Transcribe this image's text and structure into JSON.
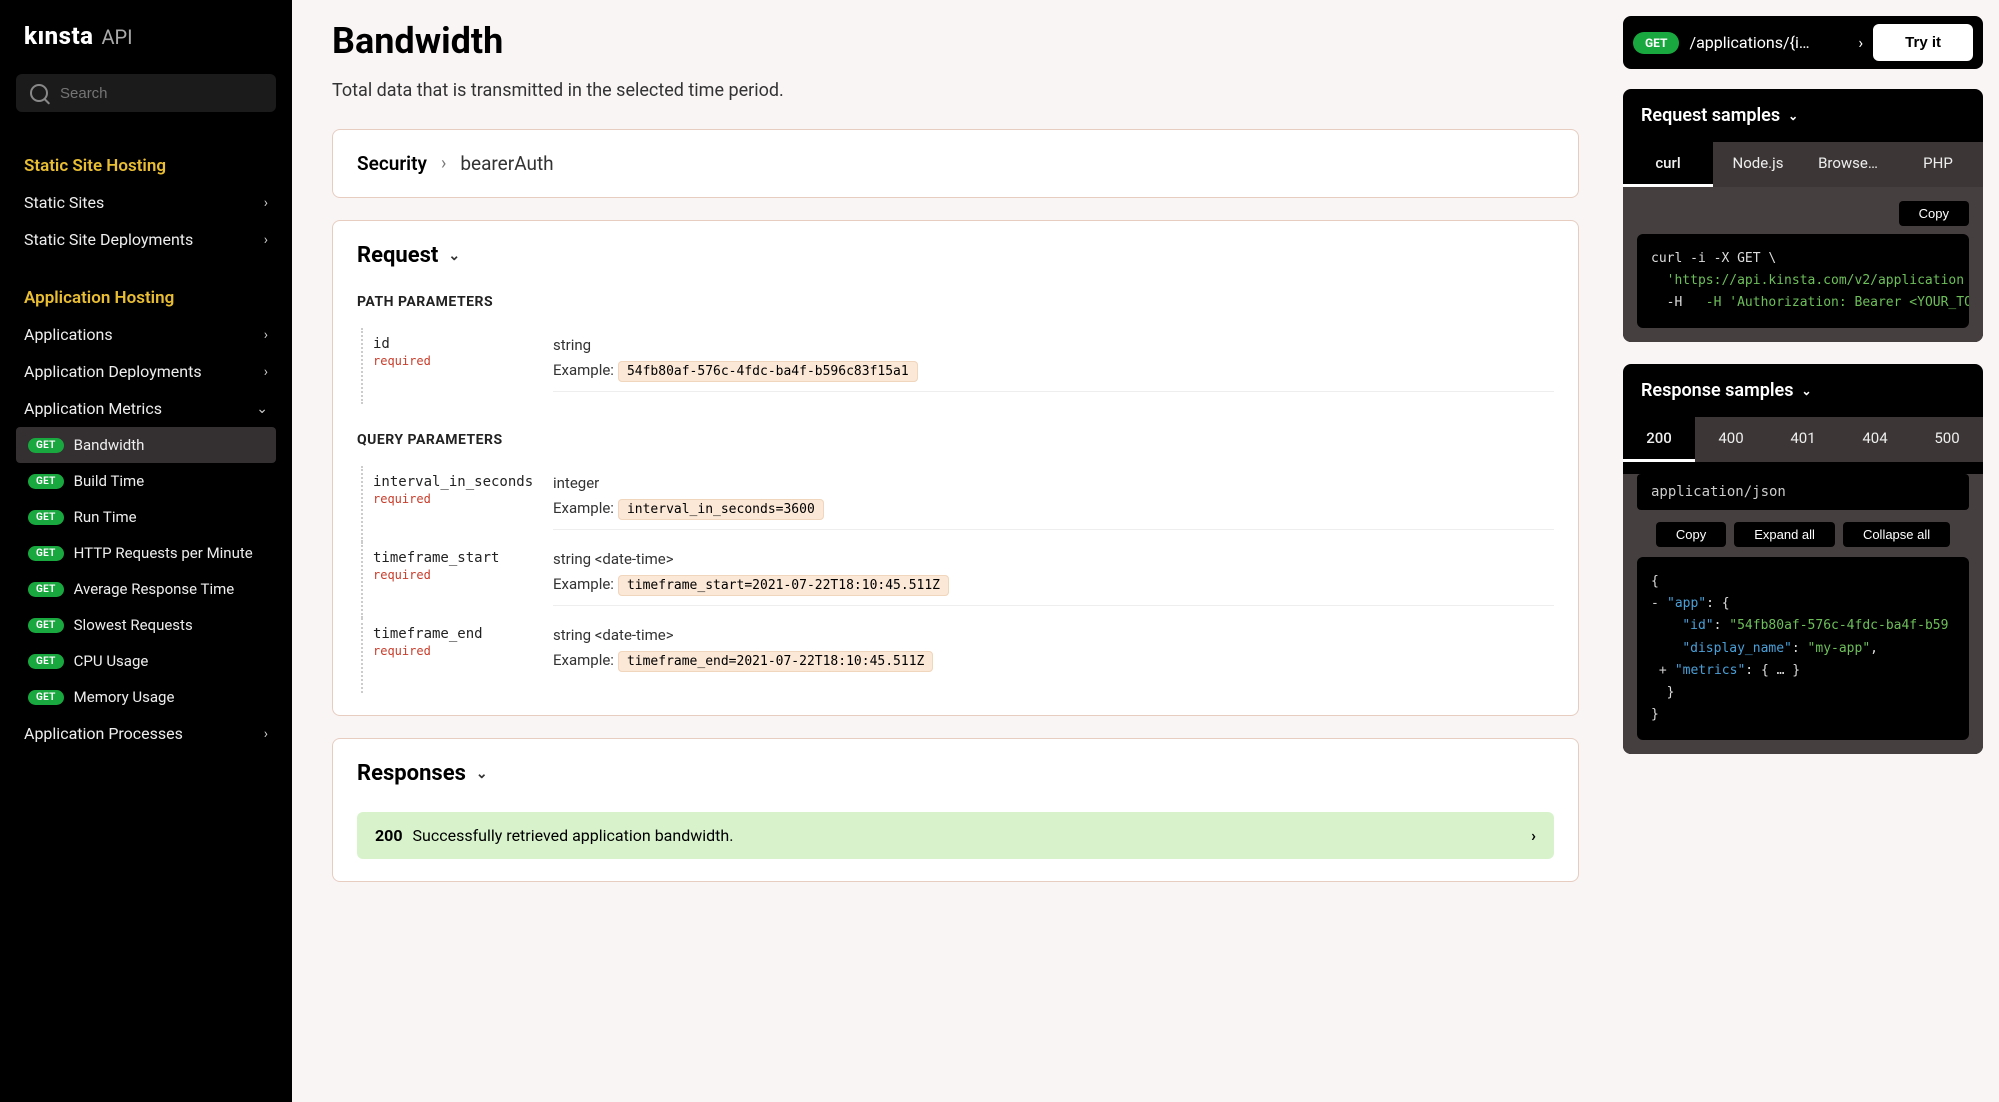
{
  "brand": {
    "name": "kınsta",
    "suffix": "API"
  },
  "search": {
    "placeholder": "Search"
  },
  "sidebar": {
    "sections": [
      {
        "title": "Static Site Hosting",
        "items": [
          {
            "label": "Static Sites",
            "chevron": "›"
          },
          {
            "label": "Static Site Deployments",
            "chevron": "›"
          }
        ]
      },
      {
        "title": "Application Hosting",
        "items": [
          {
            "label": "Applications",
            "chevron": "›"
          },
          {
            "label": "Application Deployments",
            "chevron": "›"
          },
          {
            "label": "Application Metrics",
            "chevron": "⌄",
            "expanded": true,
            "children": [
              {
                "method": "GET",
                "label": "Bandwidth",
                "active": true
              },
              {
                "method": "GET",
                "label": "Build Time"
              },
              {
                "method": "GET",
                "label": "Run Time"
              },
              {
                "method": "GET",
                "label": "HTTP Requests per Minute"
              },
              {
                "method": "GET",
                "label": "Average Response Time"
              },
              {
                "method": "GET",
                "label": "Slowest Requests"
              },
              {
                "method": "GET",
                "label": "CPU Usage"
              },
              {
                "method": "GET",
                "label": "Memory Usage"
              }
            ]
          },
          {
            "label": "Application Processes",
            "chevron": "›"
          }
        ]
      }
    ]
  },
  "page": {
    "title": "Bandwidth",
    "description": "Total data that is transmitted in the selected time period.",
    "security": {
      "label": "Security",
      "scheme": "bearerAuth"
    },
    "request": {
      "heading": "Request",
      "path_params_title": "PATH PARAMETERS",
      "query_params_title": "QUERY PARAMETERS",
      "example_label": "Example:",
      "required_label": "required",
      "path_params": [
        {
          "name": "id",
          "type": "string",
          "example": "54fb80af-576c-4fdc-ba4f-b596c83f15a1"
        }
      ],
      "query_params": [
        {
          "name": "interval_in_seconds",
          "type": "integer",
          "example": "interval_in_seconds=3600"
        },
        {
          "name": "timeframe_start",
          "type": "string <date-time>",
          "example": "timeframe_start=2021-07-22T18:10:45.511Z"
        },
        {
          "name": "timeframe_end",
          "type": "string <date-time>",
          "example": "timeframe_end=2021-07-22T18:10:45.511Z"
        }
      ]
    },
    "responses": {
      "heading": "Responses",
      "ok": {
        "code": "200",
        "text": "Successfully retrieved application bandwidth."
      }
    }
  },
  "tryit": {
    "method": "GET",
    "path": "/applications/{i…",
    "chevron": "›",
    "button": "Try it"
  },
  "request_samples": {
    "heading": "Request samples",
    "tabs": [
      "curl",
      "Node.js",
      "Browse…",
      "PHP"
    ],
    "active_tab": 0,
    "copy_label": "Copy",
    "code_prefix": "curl -i -X GET \\",
    "code_url": "  'https://api.kinsta.com/v2/application",
    "code_header": "  -H 'Authorization: Bearer <YOUR_TOKEN_"
  },
  "response_samples": {
    "heading": "Response samples",
    "tabs": [
      "200",
      "400",
      "401",
      "404",
      "500"
    ],
    "active_tab": 0,
    "content_type": "application/json",
    "buttons": {
      "copy": "Copy",
      "expand": "Expand all",
      "collapse": "Collapse all"
    },
    "json": {
      "app_key": "\"app\"",
      "id_key": "\"id\"",
      "id_val": "\"54fb80af-576c-4fdc-ba4f-b59",
      "display_name_key": "\"display_name\"",
      "display_name_val": "\"my-app\"",
      "metrics_key": "\"metrics\"",
      "metrics_val": "{ … }"
    }
  }
}
